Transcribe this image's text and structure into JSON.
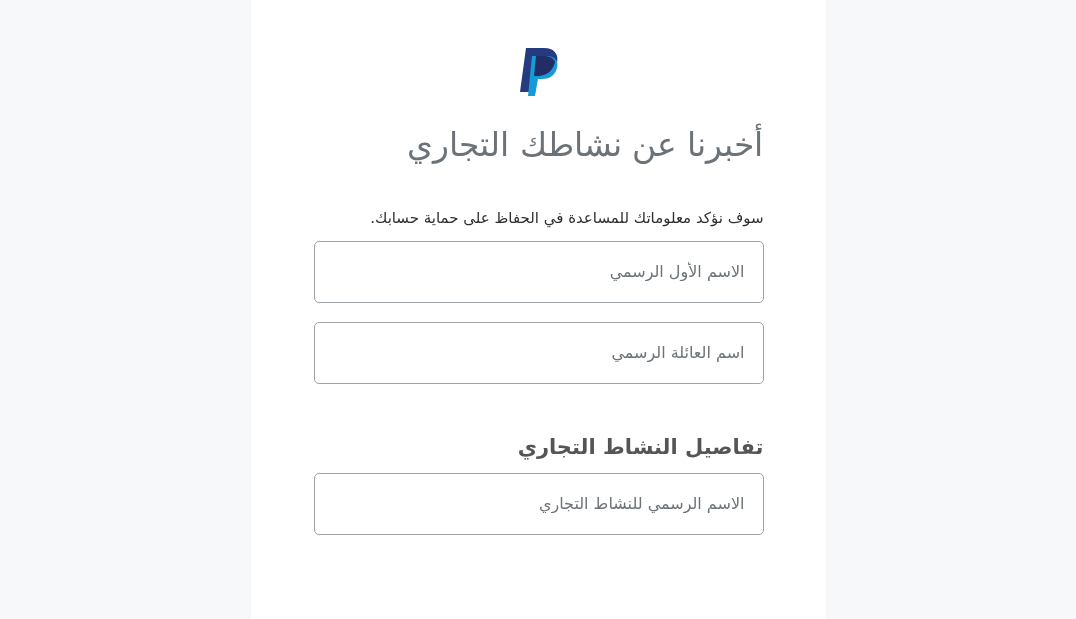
{
  "title": "أخبرنا عن نشاطك التجاري",
  "subtitle": "سوف نؤكد معلوماتك للمساعدة في الحفاظ على حماية حسابك.",
  "name_fields": [
    {
      "placeholder": "الاسم الأول الرسمي"
    },
    {
      "placeholder": "اسم العائلة الرسمي"
    }
  ],
  "business_section": {
    "heading": "تفاصيل النشاط التجاري",
    "fields": [
      {
        "placeholder": "الاسم الرسمي للنشاط التجاري"
      }
    ]
  }
}
